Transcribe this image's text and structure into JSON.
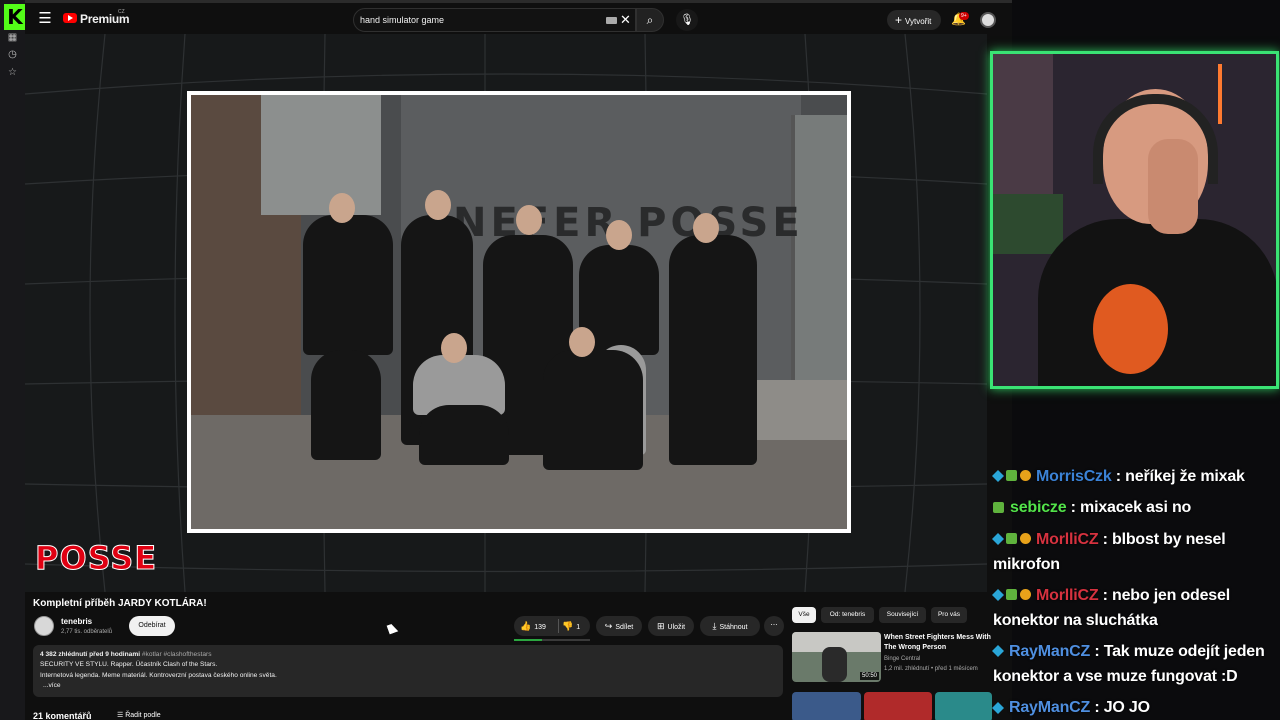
{
  "kick": {
    "logo": "K"
  },
  "topbar": {
    "brand": "Premium",
    "region": "CZ",
    "search_value": "hand simulator game",
    "create_label": "Vytvořit",
    "notification_count": "9+"
  },
  "player": {
    "wall_text": "NEFER POSSE",
    "overlay_logo": "POSSE"
  },
  "video": {
    "title": "Kompletní příběh JARDY KOTLÁRA!",
    "channel_name": "tenebris",
    "channel_subs": "2,77 tis. odběratelů",
    "subscribe_label": "Odebírat",
    "likes": "139",
    "dislikes": "1",
    "share_label": "Sdílet",
    "save_label": "Uložit",
    "download_label": "Stáhnout",
    "more_label": "⋯",
    "desc_meta": "4 382 zhlédnutí  před 9 hodinami",
    "desc_tags": "#kotlar #clashofthestars",
    "desc_line2": "SECURITY VE STYLU. Rapper. Účastník Clash of the Stars.",
    "desc_line3": "Internetová legenda. Meme materiál. Kontroverzní postava českého online světa.",
    "desc_more": "...více",
    "comments_count": "21 komentářů",
    "sort_label": "Řadit podle"
  },
  "recommendations": {
    "chips": [
      "Vše",
      "Od: tenebris",
      "Související",
      "Pro vás"
    ],
    "first": {
      "title": "When Street Fighters Mess With The Wrong Person",
      "channel": "Binge Central",
      "meta": "1,2 mil. zhlédnutí • před 1 měsícem",
      "duration": "50:50"
    }
  },
  "chat": {
    "messages": [
      {
        "user": "MorrisCzk",
        "color": "#3b82d6",
        "text": ": neříkej že mixak",
        "badges": [
          "cube",
          "gift",
          "coin"
        ]
      },
      {
        "user": "sebicze",
        "color": "#53e34a",
        "text": ": mixacek asi no",
        "badges": [
          "gift"
        ]
      },
      {
        "user": "MorlliCZ",
        "color": "#d6323f",
        "text": ": blbost by nesel mikrofon",
        "badges": [
          "cube",
          "gift",
          "coin"
        ]
      },
      {
        "user": "MorlliCZ",
        "color": "#d6323f",
        "text": ": nebo jen odesel konektor na sluchátka",
        "badges": [
          "cube",
          "gift",
          "coin"
        ]
      },
      {
        "user": "RayManCZ",
        "color": "#4f8fe0",
        "text": ": Tak muze odejít jeden konektor a vse muze fungovat :D",
        "badges": [
          "cube"
        ]
      },
      {
        "user": "RayManCZ",
        "color": "#4f8fe0",
        "text": ": JO JO",
        "badges": [
          "cube"
        ]
      }
    ]
  },
  "colors": {
    "kick_green": "#53fc18",
    "yt_red": "#ff0000",
    "webcam_border": "#3ae374"
  },
  "icons": [
    "menu-icon",
    "search-icon",
    "mic-icon",
    "bell-icon",
    "like-icon",
    "dislike-icon",
    "share-icon",
    "save-icon",
    "download-icon",
    "sort-icon"
  ]
}
